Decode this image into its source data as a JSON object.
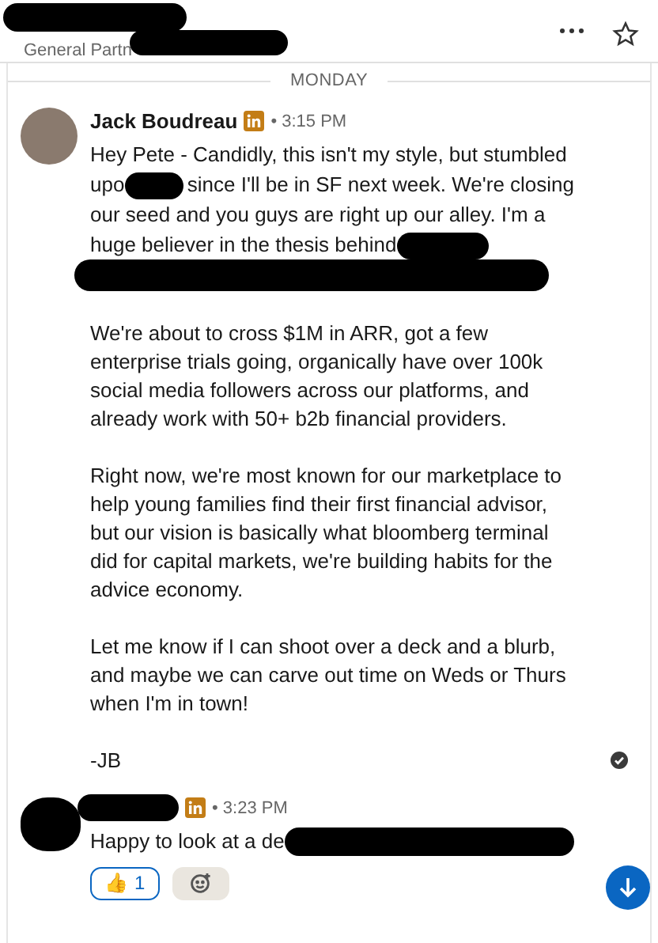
{
  "header": {
    "subtitle": "General Partn"
  },
  "day_divider": "MONDAY",
  "messages": [
    {
      "sender": "Jack Boudreau",
      "name_redacted": false,
      "avatar_redacted": false,
      "time": "• 3:15 PM",
      "read": true,
      "paragraphs": [
        {
          "lines": [
            [
              {
                "kind": "text",
                "text": "Hey Pete - Candidly, this isn't my style, but stumbled"
              }
            ],
            [
              {
                "kind": "text",
                "text": "upo"
              },
              {
                "kind": "redacted"
              },
              {
                "kind": "text",
                "text": "since I'll be in SF next week. We're closing"
              }
            ],
            [
              {
                "kind": "text",
                "text": "our seed and you guys are right up our alley. I'm a"
              }
            ],
            [
              {
                "kind": "text",
                "text": "huge believer in the thesis behind"
              },
              {
                "kind": "redacted"
              }
            ],
            [
              {
                "kind": "redacted_line"
              }
            ]
          ]
        },
        {
          "text": "We're about to cross $1M in ARR, got a few enterprise trials going, organically have over 100k social media followers across our platforms, and already work with 50+ b2b financial providers."
        },
        {
          "text": "Right now, we're most known for our marketplace to help young families find their first financial advisor, but our vision is basically what bloomberg terminal did for capital markets, we're building habits for the advice economy."
        },
        {
          "text": "Let me know if I can shoot over a deck and a blurb, and maybe we can carve out time on Weds or Thurs when I'm in town!"
        },
        {
          "text": "-JB"
        }
      ]
    },
    {
      "name_redacted": true,
      "avatar_redacted": true,
      "time": "• 3:23 PM",
      "paragraphs": [
        {
          "lines": [
            [
              {
                "kind": "text",
                "text": "Happy to look at a de"
              },
              {
                "kind": "redacted_wide"
              }
            ]
          ]
        }
      ],
      "reactions": [
        {
          "emoji": "👍",
          "count": "1",
          "selected": true
        }
      ]
    }
  ]
}
